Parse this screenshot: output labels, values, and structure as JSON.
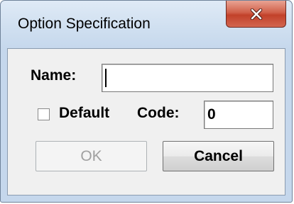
{
  "window": {
    "title": "Option Specification"
  },
  "form": {
    "name_label": "Name:",
    "name_value": "",
    "default_label": "Default",
    "default_checked": false,
    "code_label": "Code:",
    "code_value": "0"
  },
  "buttons": {
    "ok_label": "OK",
    "ok_enabled": false,
    "cancel_label": "Cancel"
  },
  "icons": {
    "close": "close-icon"
  },
  "colors": {
    "title_gradient_top": "#dfeaf6",
    "close_button": "#c2412a",
    "client_background": "#f0f0f0"
  }
}
